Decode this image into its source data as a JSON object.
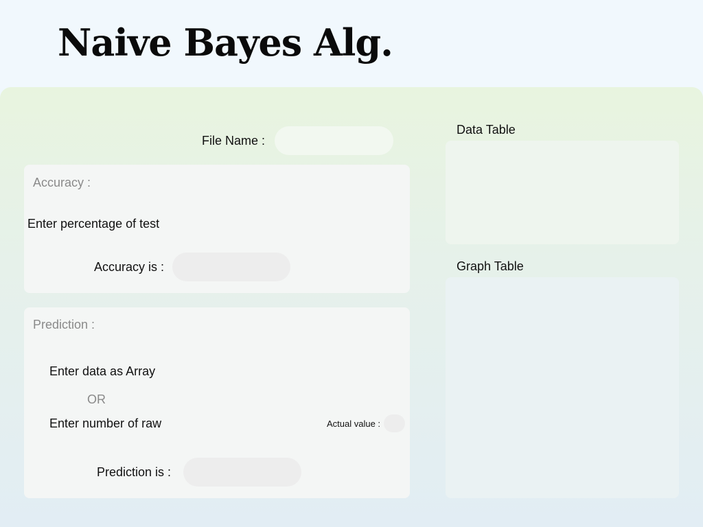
{
  "header": {
    "title": "Naive Bayes Alg."
  },
  "file": {
    "label": "File Name :",
    "value": ""
  },
  "accuracy": {
    "section_title": "Accuracy :",
    "test_prompt": "Enter percentage of test",
    "result_label": "Accuracy is :",
    "result_value": ""
  },
  "prediction": {
    "section_title": "Prediction :",
    "array_prompt": "Enter data as Array",
    "or_label": "OR",
    "row_prompt": "Enter number of raw",
    "actual_label": "Actual value :",
    "actual_value": "",
    "result_label": "Prediction is :",
    "result_value": ""
  },
  "data_table": {
    "title": "Data Table"
  },
  "graph_table": {
    "title": "Graph Table"
  },
  "colors": {
    "card_bg": "#f4f6f5",
    "field_bg": "#ededed",
    "muted_text": "#8a8a8a"
  }
}
